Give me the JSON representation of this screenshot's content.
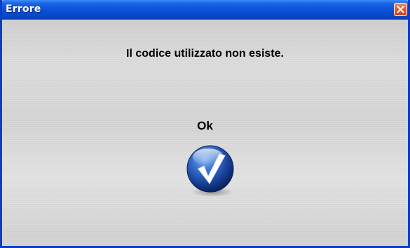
{
  "window": {
    "title": "Errore"
  },
  "dialog": {
    "message": "Il codice utilizzato non esiste.",
    "ok_label": "Ok"
  },
  "icons": {
    "close": "close-icon",
    "ok": "checkmark-icon"
  },
  "colors": {
    "titlebar": "#0a4fd6",
    "close_button": "#e25a32",
    "ok_button": "#1d4fae",
    "background": "#d8d8d8"
  }
}
